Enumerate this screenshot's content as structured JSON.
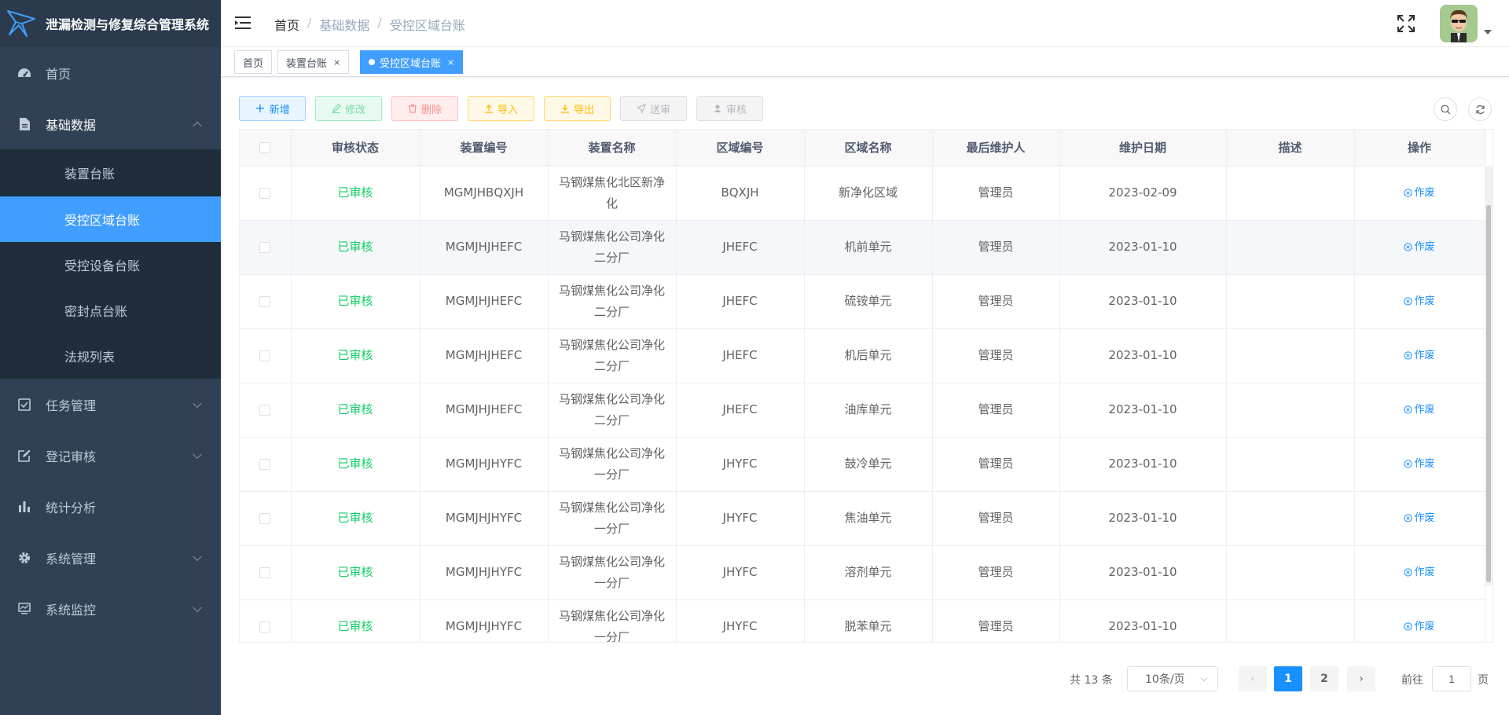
{
  "app": {
    "title": "泄漏检测与修复综合管理系统"
  },
  "sidebar": {
    "items": [
      {
        "label": "首页",
        "icon": "dashboard-icon"
      },
      {
        "label": "基础数据",
        "icon": "document-icon",
        "expanded": true
      },
      {
        "label": "任务管理",
        "icon": "checkbox-icon"
      },
      {
        "label": "登记审核",
        "icon": "edit-icon"
      },
      {
        "label": "统计分析",
        "icon": "bar-chart-icon"
      },
      {
        "label": "系统管理",
        "icon": "gear-icon"
      },
      {
        "label": "系统监控",
        "icon": "monitor-icon"
      }
    ],
    "sub_items": [
      {
        "label": "装置台账"
      },
      {
        "label": "受控区域台账",
        "active": true
      },
      {
        "label": "受控设备台账"
      },
      {
        "label": "密封点台账"
      },
      {
        "label": "法规列表"
      }
    ]
  },
  "breadcrumb": [
    "首页",
    "基础数据",
    "受控区域台账"
  ],
  "tags": [
    {
      "label": "首页"
    },
    {
      "label": "装置台账"
    },
    {
      "label": "受控区域台账",
      "active": true
    }
  ],
  "toolbar": {
    "add": "新增",
    "edit": "修改",
    "delete": "删除",
    "import": "导入",
    "export": "导出",
    "send": "送审",
    "audit": "审核"
  },
  "table": {
    "columns": [
      "审核状态",
      "装置编号",
      "装置名称",
      "区域编号",
      "区域名称",
      "最后维护人",
      "维护日期",
      "描述",
      "操作"
    ],
    "rows": [
      {
        "status": "已审核",
        "device_code": "MGMJHBQXJH",
        "device_name": "马钢煤焦化北区新净化",
        "area_code": "BQXJH",
        "area_name": "新净化区域",
        "maintainer": "管理员",
        "date": "2023-02-09",
        "desc": "",
        "action": "作废"
      },
      {
        "status": "已审核",
        "device_code": "MGMJHJHEFC",
        "device_name": "马钢煤焦化公司净化二分厂",
        "area_code": "JHEFC",
        "area_name": "机前单元",
        "maintainer": "管理员",
        "date": "2023-01-10",
        "desc": "",
        "action": "作废"
      },
      {
        "status": "已审核",
        "device_code": "MGMJHJHEFC",
        "device_name": "马钢煤焦化公司净化二分厂",
        "area_code": "JHEFC",
        "area_name": "硫铵单元",
        "maintainer": "管理员",
        "date": "2023-01-10",
        "desc": "",
        "action": "作废"
      },
      {
        "status": "已审核",
        "device_code": "MGMJHJHEFC",
        "device_name": "马钢煤焦化公司净化二分厂",
        "area_code": "JHEFC",
        "area_name": "机后单元",
        "maintainer": "管理员",
        "date": "2023-01-10",
        "desc": "",
        "action": "作废"
      },
      {
        "status": "已审核",
        "device_code": "MGMJHJHEFC",
        "device_name": "马钢煤焦化公司净化二分厂",
        "area_code": "JHEFC",
        "area_name": "油库单元",
        "maintainer": "管理员",
        "date": "2023-01-10",
        "desc": "",
        "action": "作废"
      },
      {
        "status": "已审核",
        "device_code": "MGMJHJHYFC",
        "device_name": "马钢煤焦化公司净化一分厂",
        "area_code": "JHYFC",
        "area_name": "鼓冷单元",
        "maintainer": "管理员",
        "date": "2023-01-10",
        "desc": "",
        "action": "作废"
      },
      {
        "status": "已审核",
        "device_code": "MGMJHJHYFC",
        "device_name": "马钢煤焦化公司净化一分厂",
        "area_code": "JHYFC",
        "area_name": "焦油单元",
        "maintainer": "管理员",
        "date": "2023-01-10",
        "desc": "",
        "action": "作废"
      },
      {
        "status": "已审核",
        "device_code": "MGMJHJHYFC",
        "device_name": "马钢煤焦化公司净化一分厂",
        "area_code": "JHYFC",
        "area_name": "溶剂单元",
        "maintainer": "管理员",
        "date": "2023-01-10",
        "desc": "",
        "action": "作废"
      },
      {
        "status": "已审核",
        "device_code": "MGMJHJHYFC",
        "device_name": "马钢煤焦化公司净化一分厂",
        "area_code": "JHYFC",
        "area_name": "脱苯单元",
        "maintainer": "管理员",
        "date": "2023-01-10",
        "desc": "",
        "action": "作废"
      }
    ]
  },
  "pagination": {
    "total": "共 13 条",
    "page_size": "10条/页",
    "pages": [
      "1",
      "2"
    ],
    "current": "1",
    "goto_label": "前往",
    "goto_value": "1",
    "page_suffix": "页"
  },
  "colors": {
    "sidebar_bg": "#304156",
    "submenu_bg": "#1f2d3d",
    "accent": "#409eff",
    "status_green": "#13ce66"
  }
}
